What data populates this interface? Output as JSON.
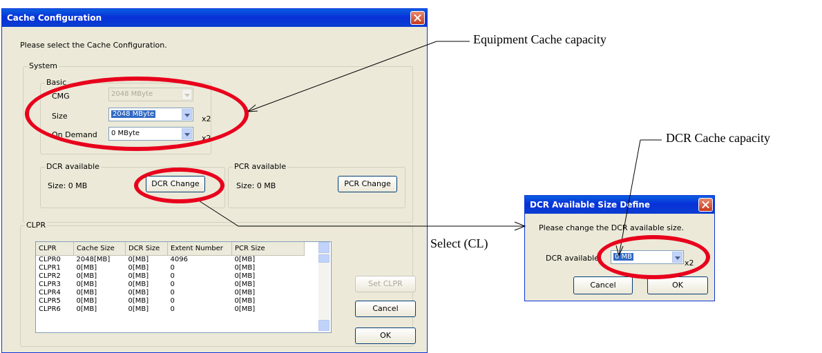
{
  "main_dialog": {
    "title": "Cache Configuration",
    "prompt": "Please select the Cache Configuration.",
    "system_label": "System",
    "basic_label": "Basic",
    "cmg_label": "CMG",
    "cmg_value": "2048 MByte",
    "size_label": "Size",
    "size_value": "2048 MByte",
    "size_mult": "x2",
    "ondemand_label": "On Demand",
    "ondemand_value": "0 MByte",
    "ondemand_mult": "x2",
    "dcr_label": "DCR available",
    "dcr_size": "Size: 0 MB",
    "dcr_button": "DCR Change",
    "pcr_label": "PCR available",
    "pcr_size": "Size: 0 MB",
    "pcr_button": "PCR Change",
    "clpr_label": "CLPR",
    "columns": [
      "CLPR",
      "Cache Size",
      "DCR Size",
      "Extent Number",
      "PCR Size"
    ],
    "rows": [
      [
        "CLPR0",
        "2048[MB]",
        "0[MB]",
        "4096",
        "0[MB]"
      ],
      [
        "CLPR1",
        "0[MB]",
        "0[MB]",
        "0",
        "0[MB]"
      ],
      [
        "CLPR2",
        "0[MB]",
        "0[MB]",
        "0",
        "0[MB]"
      ],
      [
        "CLPR3",
        "0[MB]",
        "0[MB]",
        "0",
        "0[MB]"
      ],
      [
        "CLPR4",
        "0[MB]",
        "0[MB]",
        "0",
        "0[MB]"
      ],
      [
        "CLPR5",
        "0[MB]",
        "0[MB]",
        "0",
        "0[MB]"
      ],
      [
        "CLPR6",
        "0[MB]",
        "0[MB]",
        "0",
        "0[MB]"
      ]
    ],
    "set_clpr_button": "Set CLPR",
    "cancel_button": "Cancel",
    "ok_button": "OK"
  },
  "small_dialog": {
    "title": "DCR Available Size Define",
    "prompt": "Please change the DCR available size.",
    "dcr_label": "DCR available",
    "dcr_value": "0 MB",
    "dcr_mult": "x2",
    "cancel_button": "Cancel",
    "ok_button": "OK"
  },
  "annotations": {
    "equipment": "Equipment Cache capacity",
    "dcr_cache": "DCR Cache capacity",
    "select": "Select (CL)"
  },
  "colors": {
    "highlight": "#e8001c",
    "titlebar": "#0831d9",
    "dialog_bg": "#ece9d8"
  }
}
